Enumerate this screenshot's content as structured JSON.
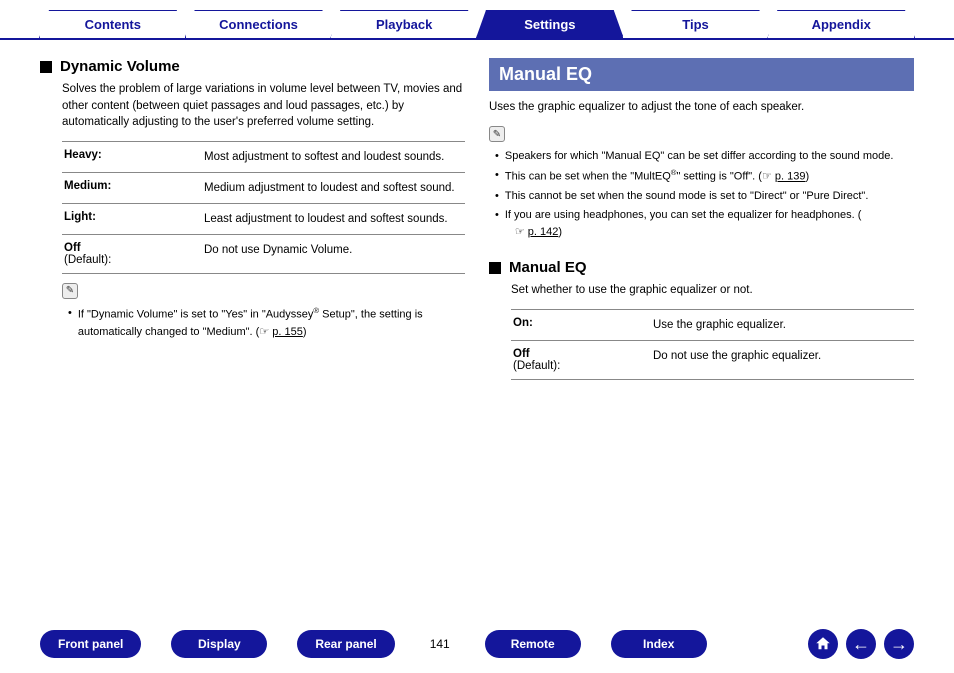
{
  "tabs": {
    "contents": "Contents",
    "connections": "Connections",
    "playback": "Playback",
    "settings": "Settings",
    "tips": "Tips",
    "appendix": "Appendix"
  },
  "left": {
    "heading": "Dynamic Volume",
    "lead": "Solves the problem of large variations in volume level between TV, movies and other content (between quiet passages and loud passages, etc.) by automatically adjusting to the user's preferred volume setting.",
    "rows": [
      {
        "label": "Heavy:",
        "sub": "",
        "desc": "Most adjustment to softest and loudest sounds."
      },
      {
        "label": "Medium:",
        "sub": "",
        "desc": "Medium adjustment to loudest and softest sound."
      },
      {
        "label": "Light:",
        "sub": "",
        "desc": "Least adjustment to loudest and softest sounds."
      },
      {
        "label": "Off",
        "sub": "(Default):",
        "desc": "Do not use Dynamic Volume."
      }
    ],
    "note_bullet_pre": "If \"Dynamic Volume\" is set to \"Yes\" in \"Audyssey",
    "note_bullet_mid": " Setup\", the setting is automatically changed to \"Medium\".  (",
    "note_bullet_link": "p. 155",
    "note_bullet_post": ")"
  },
  "right": {
    "banner": "Manual EQ",
    "lead": "Uses the graphic equalizer to adjust the tone of each speaker.",
    "bullets": [
      {
        "text": "Speakers for which \"Manual EQ\" can be set differ according to the sound mode."
      },
      {
        "text_pre": "This can be set when the \"MultEQ",
        "text_mid": "\" setting is \"Off\".  (",
        "link": "p. 139",
        "text_post": ")"
      },
      {
        "text": "This cannot be set when the sound mode is set to \"Direct\" or \"Pure Direct\"."
      },
      {
        "text_pre": "If you are using headphones, you can set the equalizer for headphones. (",
        "link": "p. 142",
        "text_post": ")",
        "wrap": true
      }
    ],
    "sub_heading": "Manual EQ",
    "sub_lead": "Set whether to use the graphic equalizer or not.",
    "rows": [
      {
        "label": "On:",
        "sub": "",
        "desc": "Use the graphic equalizer."
      },
      {
        "label": "Off",
        "sub": "(Default):",
        "desc": "Do not use the graphic equalizer."
      }
    ]
  },
  "bottom": {
    "front_panel": "Front panel",
    "display": "Display",
    "rear_panel": "Rear panel",
    "remote": "Remote",
    "index": "Index",
    "page": "141"
  },
  "glyphs": {
    "hand": "☞",
    "reg": "®",
    "pencil": "✎"
  }
}
